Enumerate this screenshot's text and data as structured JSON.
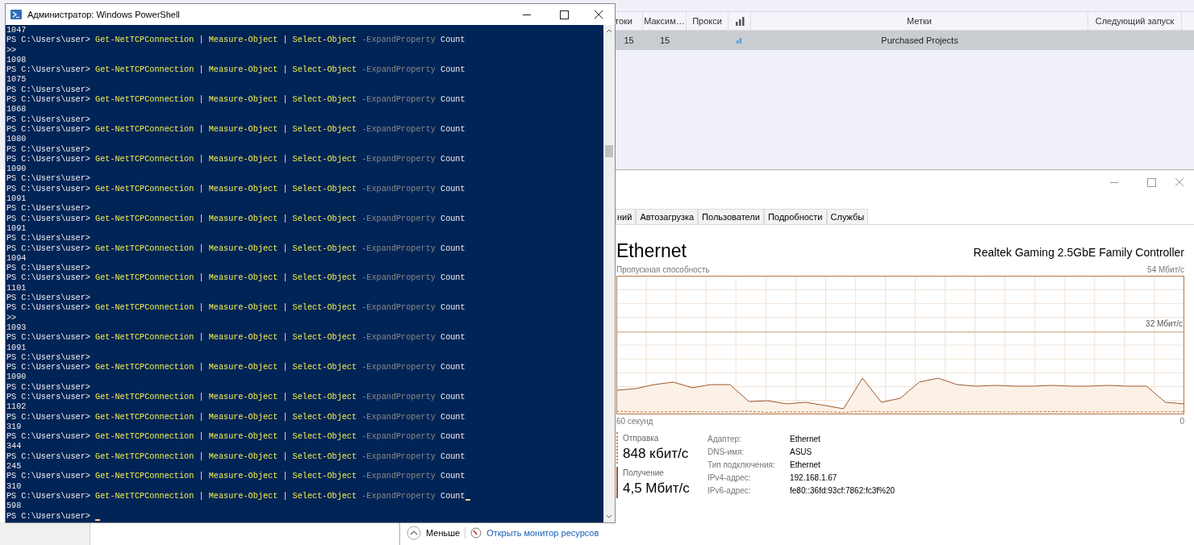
{
  "background_app": {
    "table": {
      "columns": [
        {
          "kind": "text",
          "label": "токи"
        },
        {
          "kind": "text",
          "label": "Максим…"
        },
        {
          "kind": "text",
          "label": "Прокси"
        },
        {
          "kind": "icon"
        },
        {
          "kind": "text",
          "label": "Метки"
        },
        {
          "kind": "text",
          "label": "Следующий запуск"
        }
      ],
      "rows": [
        {
          "selected": true,
          "cells": [
            {
              "kind": "text",
              "text": "15"
            },
            {
              "kind": "text",
              "text": "15"
            },
            {
              "kind": "blank"
            },
            {
              "kind": "icon"
            },
            {
              "kind": "text",
              "text": "Purchased Projects"
            },
            {
              "kind": "blank"
            }
          ]
        }
      ]
    }
  },
  "powershell": {
    "title": "Администратор: Windows PowerShell",
    "lines": [
      {
        "kind": "output",
        "text": "1047"
      },
      {
        "kind": "command",
        "prompt": "PS C:\\Users\\user>",
        "tokens": [
          {
            "kind": "cmdlet",
            "text": "Get-NetTCPConnection"
          },
          {
            "kind": "pipe",
            "text": "|"
          },
          {
            "kind": "cmdlet",
            "text": "Measure-Object"
          },
          {
            "kind": "pipe",
            "text": "|"
          },
          {
            "kind": "cmdlet",
            "text": "Select-Object"
          },
          {
            "kind": "param",
            "text": "-ExpandProperty"
          },
          {
            "kind": "arg",
            "text": "Count"
          }
        ]
      },
      {
        "kind": "output",
        "text": ">>"
      },
      {
        "kind": "output",
        "text": "1098"
      },
      {
        "kind": "command",
        "prompt": "PS C:\\Users\\user>",
        "tokens": [
          {
            "kind": "cmdlet",
            "text": "Get-NetTCPConnection"
          },
          {
            "kind": "pipe",
            "text": "|"
          },
          {
            "kind": "cmdlet",
            "text": "Measure-Object"
          },
          {
            "kind": "pipe",
            "text": "|"
          },
          {
            "kind": "cmdlet",
            "text": "Select-Object"
          },
          {
            "kind": "param",
            "text": "-ExpandProperty"
          },
          {
            "kind": "arg",
            "text": "Count"
          }
        ]
      },
      {
        "kind": "output",
        "text": "1075"
      },
      {
        "kind": "prompt",
        "text": "PS C:\\Users\\user>"
      },
      {
        "kind": "command",
        "prompt": "PS C:\\Users\\user>",
        "tokens": [
          {
            "kind": "cmdlet",
            "text": "Get-NetTCPConnection"
          },
          {
            "kind": "pipe",
            "text": "|"
          },
          {
            "kind": "cmdlet",
            "text": "Measure-Object"
          },
          {
            "kind": "pipe",
            "text": "|"
          },
          {
            "kind": "cmdlet",
            "text": "Select-Object"
          },
          {
            "kind": "param",
            "text": "-ExpandProperty"
          },
          {
            "kind": "arg",
            "text": "Count"
          }
        ]
      },
      {
        "kind": "output",
        "text": "1068"
      },
      {
        "kind": "prompt",
        "text": "PS C:\\Users\\user>"
      },
      {
        "kind": "command",
        "prompt": "PS C:\\Users\\user>",
        "tokens": [
          {
            "kind": "cmdlet",
            "text": "Get-NetTCPConnection"
          },
          {
            "kind": "pipe",
            "text": "|"
          },
          {
            "kind": "cmdlet",
            "text": "Measure-Object"
          },
          {
            "kind": "pipe",
            "text": "|"
          },
          {
            "kind": "cmdlet",
            "text": "Select-Object"
          },
          {
            "kind": "param",
            "text": "-ExpandProperty"
          },
          {
            "kind": "arg",
            "text": "Count"
          }
        ]
      },
      {
        "kind": "output",
        "text": "1080"
      },
      {
        "kind": "prompt",
        "text": "PS C:\\Users\\user>"
      },
      {
        "kind": "command",
        "prompt": "PS C:\\Users\\user>",
        "tokens": [
          {
            "kind": "cmdlet",
            "text": "Get-NetTCPConnection"
          },
          {
            "kind": "pipe",
            "text": "|"
          },
          {
            "kind": "cmdlet",
            "text": "Measure-Object"
          },
          {
            "kind": "pipe",
            "text": "|"
          },
          {
            "kind": "cmdlet",
            "text": "Select-Object"
          },
          {
            "kind": "param",
            "text": "-ExpandProperty"
          },
          {
            "kind": "arg",
            "text": "Count"
          }
        ]
      },
      {
        "kind": "output",
        "text": "1090"
      },
      {
        "kind": "prompt",
        "text": "PS C:\\Users\\user>"
      },
      {
        "kind": "command",
        "prompt": "PS C:\\Users\\user>",
        "tokens": [
          {
            "kind": "cmdlet",
            "text": "Get-NetTCPConnection"
          },
          {
            "kind": "pipe",
            "text": "|"
          },
          {
            "kind": "cmdlet",
            "text": "Measure-Object"
          },
          {
            "kind": "pipe",
            "text": "|"
          },
          {
            "kind": "cmdlet",
            "text": "Select-Object"
          },
          {
            "kind": "param",
            "text": "-ExpandProperty"
          },
          {
            "kind": "arg",
            "text": "Count"
          }
        ]
      },
      {
        "kind": "output",
        "text": "1091"
      },
      {
        "kind": "prompt",
        "text": "PS C:\\Users\\user>"
      },
      {
        "kind": "command",
        "prompt": "PS C:\\Users\\user>",
        "tokens": [
          {
            "kind": "cmdlet",
            "text": "Get-NetTCPConnection"
          },
          {
            "kind": "pipe",
            "text": "|"
          },
          {
            "kind": "cmdlet",
            "text": "Measure-Object"
          },
          {
            "kind": "pipe",
            "text": "|"
          },
          {
            "kind": "cmdlet",
            "text": "Select-Object"
          },
          {
            "kind": "param",
            "text": "-ExpandProperty"
          },
          {
            "kind": "arg",
            "text": "Count"
          }
        ]
      },
      {
        "kind": "output",
        "text": "1091"
      },
      {
        "kind": "prompt",
        "text": "PS C:\\Users\\user>"
      },
      {
        "kind": "command",
        "prompt": "PS C:\\Users\\user>",
        "tokens": [
          {
            "kind": "cmdlet",
            "text": "Get-NetTCPConnection"
          },
          {
            "kind": "pipe",
            "text": "|"
          },
          {
            "kind": "cmdlet",
            "text": "Measure-Object"
          },
          {
            "kind": "pipe",
            "text": "|"
          },
          {
            "kind": "cmdlet",
            "text": "Select-Object"
          },
          {
            "kind": "param",
            "text": "-ExpandProperty"
          },
          {
            "kind": "arg",
            "text": "Count"
          }
        ]
      },
      {
        "kind": "output",
        "text": "1094"
      },
      {
        "kind": "prompt",
        "text": "PS C:\\Users\\user>"
      },
      {
        "kind": "command",
        "prompt": "PS C:\\Users\\user>",
        "tokens": [
          {
            "kind": "cmdlet",
            "text": "Get-NetTCPConnection"
          },
          {
            "kind": "pipe",
            "text": "|"
          },
          {
            "kind": "cmdlet",
            "text": "Measure-Object"
          },
          {
            "kind": "pipe",
            "text": "|"
          },
          {
            "kind": "cmdlet",
            "text": "Select-Object"
          },
          {
            "kind": "param",
            "text": "-ExpandProperty"
          },
          {
            "kind": "arg",
            "text": "Count"
          }
        ]
      },
      {
        "kind": "output",
        "text": "1101"
      },
      {
        "kind": "prompt",
        "text": "PS C:\\Users\\user>"
      },
      {
        "kind": "command",
        "prompt": "PS C:\\Users\\user>",
        "tokens": [
          {
            "kind": "cmdlet",
            "text": "Get-NetTCPConnection"
          },
          {
            "kind": "pipe",
            "text": "|"
          },
          {
            "kind": "cmdlet",
            "text": "Measure-Object"
          },
          {
            "kind": "pipe",
            "text": "|"
          },
          {
            "kind": "cmdlet",
            "text": "Select-Object"
          },
          {
            "kind": "param",
            "text": "-ExpandProperty"
          },
          {
            "kind": "arg",
            "text": "Count"
          }
        ]
      },
      {
        "kind": "output",
        "text": ">>"
      },
      {
        "kind": "output",
        "text": "1093"
      },
      {
        "kind": "command",
        "prompt": "PS C:\\Users\\user>",
        "tokens": [
          {
            "kind": "cmdlet",
            "text": "Get-NetTCPConnection"
          },
          {
            "kind": "pipe",
            "text": "|"
          },
          {
            "kind": "cmdlet",
            "text": "Measure-Object"
          },
          {
            "kind": "pipe",
            "text": "|"
          },
          {
            "kind": "cmdlet",
            "text": "Select-Object"
          },
          {
            "kind": "param",
            "text": "-ExpandProperty"
          },
          {
            "kind": "arg",
            "text": "Count"
          }
        ]
      },
      {
        "kind": "output",
        "text": "1091"
      },
      {
        "kind": "prompt",
        "text": "PS C:\\Users\\user>"
      },
      {
        "kind": "command",
        "prompt": "PS C:\\Users\\user>",
        "tokens": [
          {
            "kind": "cmdlet",
            "text": "Get-NetTCPConnection"
          },
          {
            "kind": "pipe",
            "text": "|"
          },
          {
            "kind": "cmdlet",
            "text": "Measure-Object"
          },
          {
            "kind": "pipe",
            "text": "|"
          },
          {
            "kind": "cmdlet",
            "text": "Select-Object"
          },
          {
            "kind": "param",
            "text": "-ExpandProperty"
          },
          {
            "kind": "arg",
            "text": "Count"
          }
        ]
      },
      {
        "kind": "output",
        "text": "1090"
      },
      {
        "kind": "prompt",
        "text": "PS C:\\Users\\user>"
      },
      {
        "kind": "command",
        "prompt": "PS C:\\Users\\user>",
        "tokens": [
          {
            "kind": "cmdlet",
            "text": "Get-NetTCPConnection"
          },
          {
            "kind": "pipe",
            "text": "|"
          },
          {
            "kind": "cmdlet",
            "text": "Measure-Object"
          },
          {
            "kind": "pipe",
            "text": "|"
          },
          {
            "kind": "cmdlet",
            "text": "Select-Object"
          },
          {
            "kind": "param",
            "text": "-ExpandProperty"
          },
          {
            "kind": "arg",
            "text": "Count"
          }
        ]
      },
      {
        "kind": "output",
        "text": "1102"
      },
      {
        "kind": "command",
        "prompt": "PS C:\\Users\\user>",
        "tokens": [
          {
            "kind": "cmdlet",
            "text": "Get-NetTCPConnection"
          },
          {
            "kind": "pipe",
            "text": "|"
          },
          {
            "kind": "cmdlet",
            "text": "Measure-Object"
          },
          {
            "kind": "pipe",
            "text": "|"
          },
          {
            "kind": "cmdlet",
            "text": "Select-Object"
          },
          {
            "kind": "param",
            "text": "-ExpandProperty"
          },
          {
            "kind": "arg",
            "text": "Count"
          }
        ]
      },
      {
        "kind": "output",
        "text": "319"
      },
      {
        "kind": "command",
        "prompt": "PS C:\\Users\\user>",
        "tokens": [
          {
            "kind": "cmdlet",
            "text": "Get-NetTCPConnection"
          },
          {
            "kind": "pipe",
            "text": "|"
          },
          {
            "kind": "cmdlet",
            "text": "Measure-Object"
          },
          {
            "kind": "pipe",
            "text": "|"
          },
          {
            "kind": "cmdlet",
            "text": "Select-Object"
          },
          {
            "kind": "param",
            "text": "-ExpandProperty"
          },
          {
            "kind": "arg",
            "text": "Count"
          }
        ]
      },
      {
        "kind": "output",
        "text": "344"
      },
      {
        "kind": "command",
        "prompt": "PS C:\\Users\\user>",
        "tokens": [
          {
            "kind": "cmdlet",
            "text": "Get-NetTCPConnection"
          },
          {
            "kind": "pipe",
            "text": "|"
          },
          {
            "kind": "cmdlet",
            "text": "Measure-Object"
          },
          {
            "kind": "pipe",
            "text": "|"
          },
          {
            "kind": "cmdlet",
            "text": "Select-Object"
          },
          {
            "kind": "param",
            "text": "-ExpandProperty"
          },
          {
            "kind": "arg",
            "text": "Count"
          }
        ]
      },
      {
        "kind": "output",
        "text": "245"
      },
      {
        "kind": "command",
        "prompt": "PS C:\\Users\\user>",
        "tokens": [
          {
            "kind": "cmdlet",
            "text": "Get-NetTCPConnection"
          },
          {
            "kind": "pipe",
            "text": "|"
          },
          {
            "kind": "cmdlet",
            "text": "Measure-Object"
          },
          {
            "kind": "pipe",
            "text": "|"
          },
          {
            "kind": "cmdlet",
            "text": "Select-Object"
          },
          {
            "kind": "param",
            "text": "-ExpandProperty"
          },
          {
            "kind": "arg",
            "text": "Count"
          }
        ]
      },
      {
        "kind": "output",
        "text": "310"
      },
      {
        "kind": "command",
        "prompt": "PS C:\\Users\\user>",
        "cursor": true,
        "tokens": [
          {
            "kind": "cmdlet",
            "text": "Get-NetTCPConnection"
          },
          {
            "kind": "pipe",
            "text": "|"
          },
          {
            "kind": "cmdlet",
            "text": "Measure-Object"
          },
          {
            "kind": "pipe",
            "text": "|"
          },
          {
            "kind": "cmdlet",
            "text": "Select-Object"
          },
          {
            "kind": "param",
            "text": "-ExpandProperty"
          },
          {
            "kind": "arg",
            "text": "Count"
          }
        ]
      },
      {
        "kind": "output",
        "text": "598"
      },
      {
        "kind": "prompt",
        "text": "PS C:\\Users\\user>",
        "cursor": true
      }
    ]
  },
  "task_manager": {
    "tabs": [
      {
        "label": "ний",
        "selected": false
      },
      {
        "label": "Автозагрузка",
        "selected": false
      },
      {
        "label": "Пользователи",
        "selected": false
      },
      {
        "label": "Подробности",
        "selected": false
      },
      {
        "label": "Службы",
        "selected": false
      }
    ],
    "adapter_title": "Ethernet",
    "adapter_model": "Realtek Gaming 2.5GbE Family Controller",
    "chart": {
      "caption": "Пропускная способность",
      "max_label": "54 Мбит/с",
      "scale_label": "32 Мбит/с",
      "span_label": "60 секунд",
      "end_label": "0"
    },
    "send": {
      "label": "Отправка",
      "value": "848 кбит/с"
    },
    "receive": {
      "label": "Получение",
      "value": "4,5 Мбит/с"
    },
    "properties": [
      {
        "label": "Адаптер:",
        "value": "Ethernet"
      },
      {
        "label": "DNS-имя:",
        "value": "ASUS"
      },
      {
        "label": "Тип подключения:",
        "value": "Ethernet"
      },
      {
        "label": "IPv4-адрес:",
        "value": "192.168.1.67"
      },
      {
        "label": "IPv6-адрес:",
        "value": "fe80::36fd:93cf:7862:fc3f%20"
      }
    ],
    "footer": {
      "less": "Меньше",
      "link": "Открыть монитор ресурсов"
    }
  }
}
